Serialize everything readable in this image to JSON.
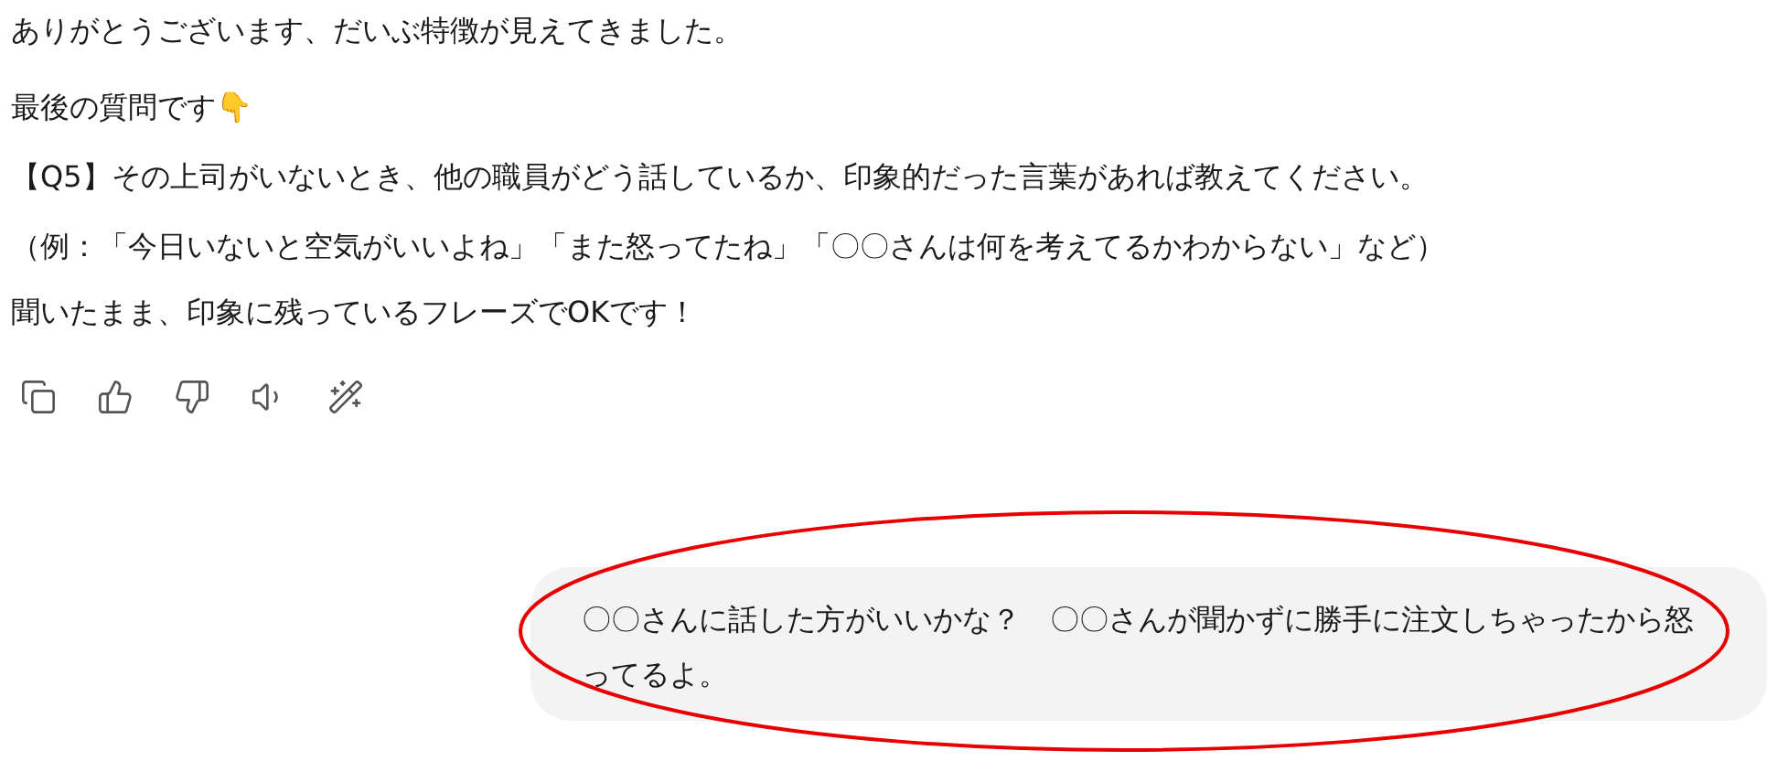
{
  "assistant_message": {
    "paragraphs": [
      {
        "lines": [
          "ありがとうございます、だいぶ特徴が見えてきました。"
        ]
      },
      {
        "lines": [
          "最後の質問です👇",
          "【Q5】その上司がいないとき、他の職員がどう話しているか、印象的だった言葉があれば教えてください。"
        ]
      },
      {
        "lines": [
          "（例：「今日いないと空気がいいよね」「また怒ってたね」「〇〇さんは何を考えてるかわからない」など）",
          "聞いたまま、印象に残っているフレーズでOKです！"
        ]
      }
    ]
  },
  "actions": [
    {
      "kind": "copy"
    },
    {
      "kind": "like"
    },
    {
      "kind": "dislike"
    },
    {
      "kind": "read-aloud"
    },
    {
      "kind": "edit"
    }
  ],
  "user_message": {
    "text": "〇〇さんに話した方がいいかな？　〇〇さんが聞かずに勝手に注文しちゃったから怒ってるよ。",
    "highlighted": true
  }
}
